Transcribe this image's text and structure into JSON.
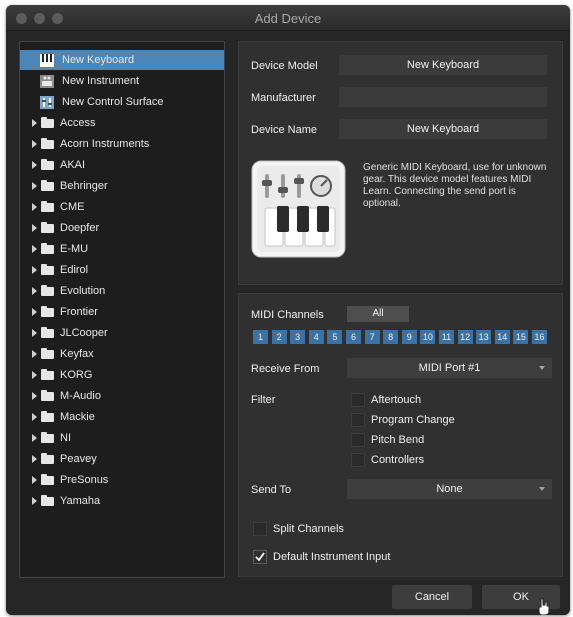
{
  "window": {
    "title": "Add Device"
  },
  "sidebar": {
    "items": [
      {
        "label": "New Keyboard",
        "icon": "keyboard-icon",
        "selected": true
      },
      {
        "label": "New Instrument",
        "icon": "instrument-icon"
      },
      {
        "label": "New Control Surface",
        "icon": "control-surface-icon"
      },
      {
        "label": "Access",
        "icon": "folder-icon"
      },
      {
        "label": "Acorn Instruments",
        "icon": "folder-icon"
      },
      {
        "label": "AKAI",
        "icon": "folder-icon"
      },
      {
        "label": "Behringer",
        "icon": "folder-icon"
      },
      {
        "label": "CME",
        "icon": "folder-icon"
      },
      {
        "label": "Doepfer",
        "icon": "folder-icon"
      },
      {
        "label": "E-MU",
        "icon": "folder-icon"
      },
      {
        "label": "Edirol",
        "icon": "folder-icon"
      },
      {
        "label": "Evolution",
        "icon": "folder-icon"
      },
      {
        "label": "Frontier",
        "icon": "folder-icon"
      },
      {
        "label": "JLCooper",
        "icon": "folder-icon"
      },
      {
        "label": "Keyfax",
        "icon": "folder-icon"
      },
      {
        "label": "KORG",
        "icon": "folder-icon"
      },
      {
        "label": "M-Audio",
        "icon": "folder-icon"
      },
      {
        "label": "Mackie",
        "icon": "folder-icon"
      },
      {
        "label": "NI",
        "icon": "folder-icon"
      },
      {
        "label": "Peavey",
        "icon": "folder-icon"
      },
      {
        "label": "PreSonus",
        "icon": "folder-icon"
      },
      {
        "label": "Yamaha",
        "icon": "folder-icon"
      }
    ]
  },
  "device": {
    "model_label": "Device Model",
    "model_value": "New Keyboard",
    "manufacturer_label": "Manufacturer",
    "manufacturer_value": "",
    "name_label": "Device Name",
    "name_value": "New Keyboard",
    "description": "Generic MIDI Keyboard, use for unknown gear. This device model features MIDI Learn. Connecting the send port is optional."
  },
  "midi": {
    "channels_label": "MIDI Channels",
    "all_label": "All",
    "channels": [
      "1",
      "2",
      "3",
      "4",
      "5",
      "6",
      "7",
      "8",
      "9",
      "10",
      "11",
      "12",
      "13",
      "14",
      "15",
      "16"
    ],
    "receive_label": "Receive From",
    "receive_value": "MIDI Port #1",
    "filter_label": "Filter",
    "filters": [
      "Aftertouch",
      "Program Change",
      "Pitch Bend",
      "Controllers"
    ],
    "send_label": "Send To",
    "send_value": "None",
    "split_label": "Split Channels",
    "split_checked": false,
    "default_label": "Default Instrument Input",
    "default_checked": true
  },
  "footer": {
    "cancel_label": "Cancel",
    "ok_label": "OK"
  },
  "colors": {
    "selection": "#4b86b8",
    "channel": "#3a72a5",
    "background": "#262626"
  }
}
